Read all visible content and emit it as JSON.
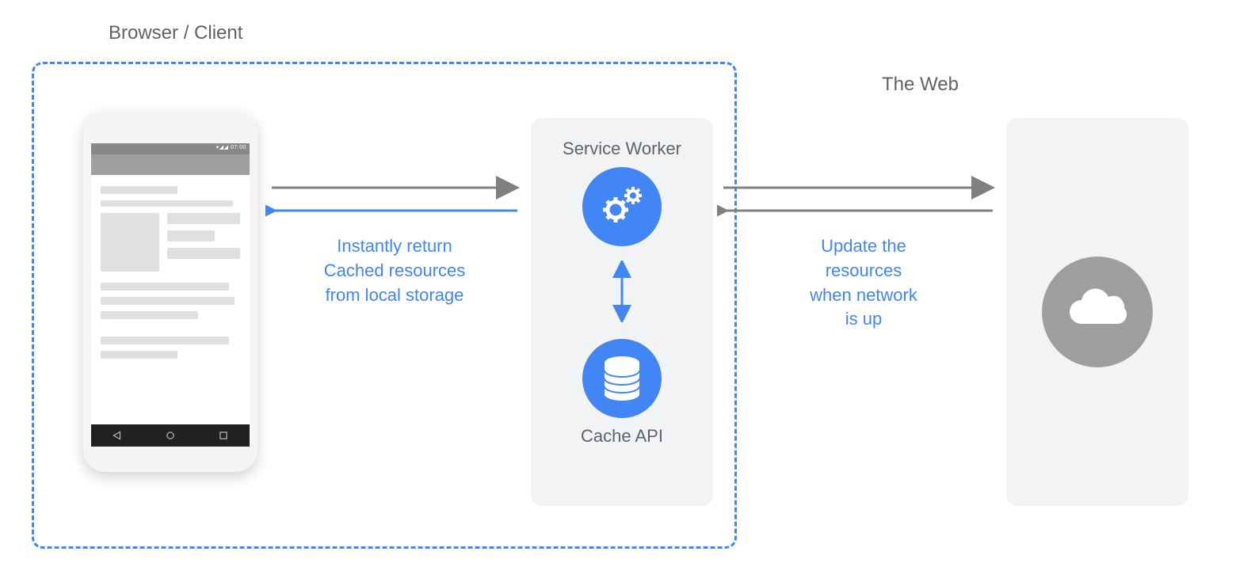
{
  "labels": {
    "browser_client": "Browser / Client",
    "the_web": "The Web",
    "service_worker": "Service Worker",
    "cache_api": "Cache API"
  },
  "phone": {
    "status_time": "▾◢◢ 07:00"
  },
  "annotations": {
    "left_line1": "Instantly return",
    "left_line2": "Cached resources",
    "left_line3": "from local storage",
    "right_line1": "Update the",
    "right_line2": "resources",
    "right_line3": "when network",
    "right_line4": "is up"
  },
  "colors": {
    "accent": "#4285f4",
    "gray": "#9e9e9e",
    "text": "#5f6368",
    "panel": "#f1f3f4"
  }
}
